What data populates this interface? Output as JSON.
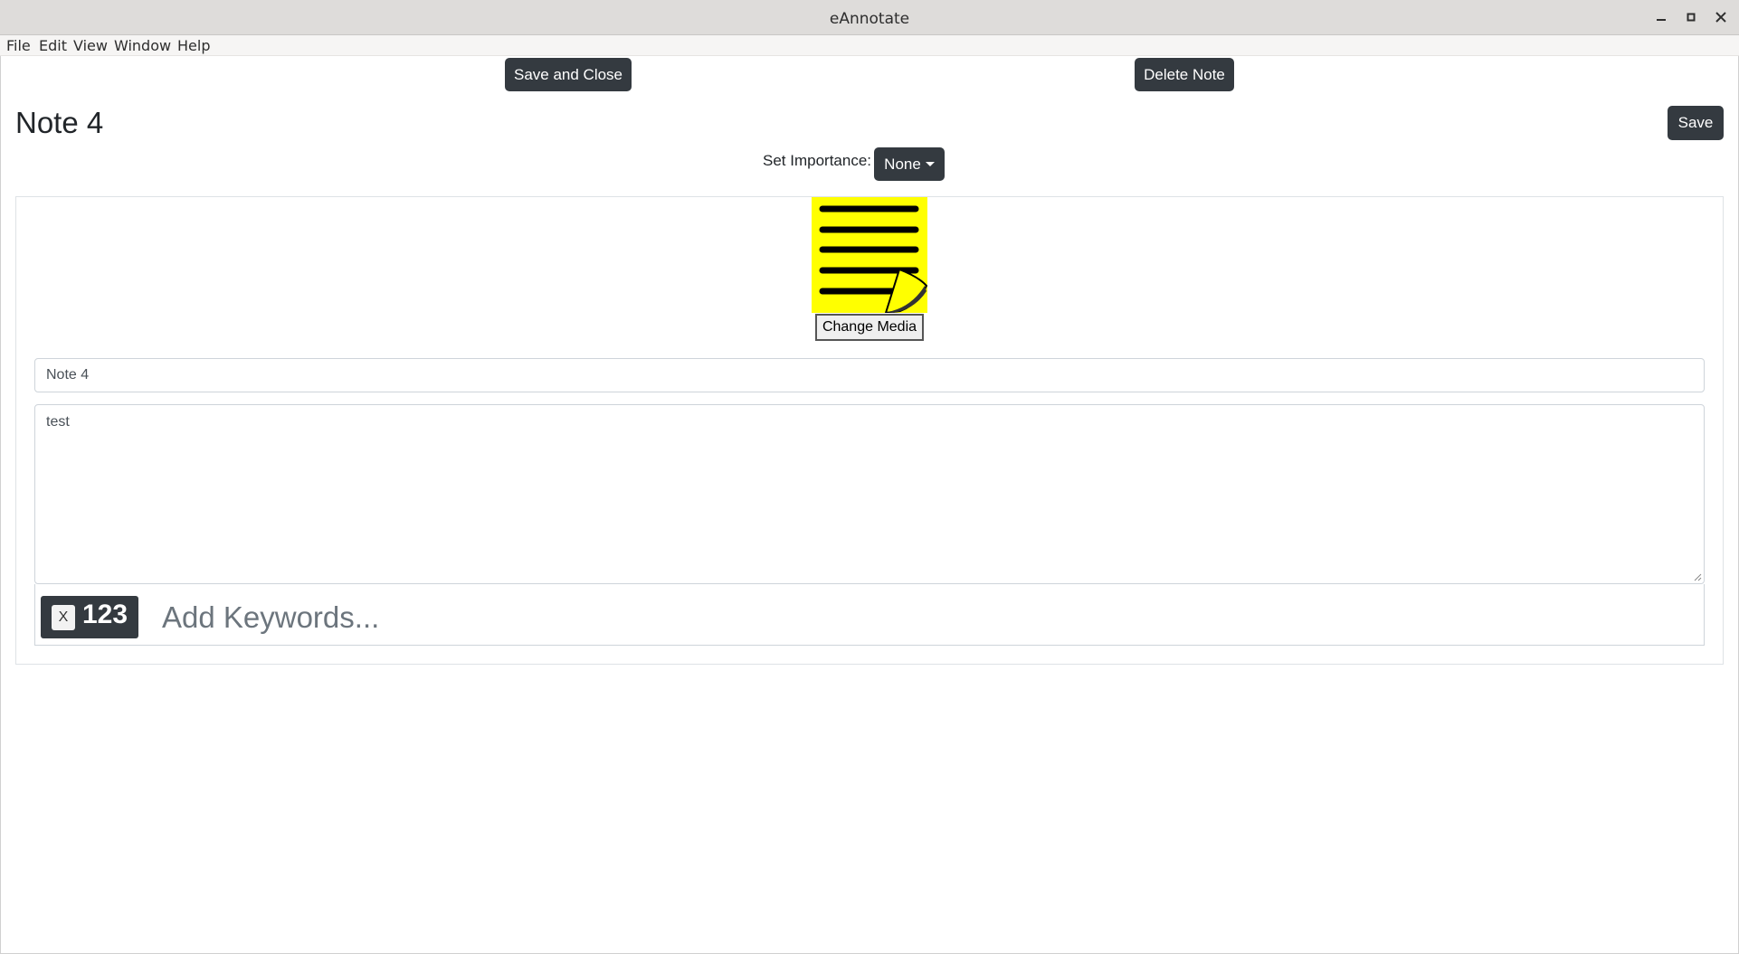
{
  "window": {
    "title": "eAnnotate"
  },
  "menubar": {
    "items": [
      "File",
      "Edit",
      "View",
      "Window",
      "Help"
    ]
  },
  "toolbar": {
    "save_close_label": "Save and Close",
    "delete_label": "Delete Note",
    "save_label": "Save"
  },
  "note": {
    "heading": "Note 4",
    "importance_label": "Set Importance:",
    "importance_value": "None",
    "change_media_label": "Change Media",
    "title_value": "Note 4",
    "body_value": "test",
    "keywords": [
      "123"
    ],
    "keywords_placeholder": "Add Keywords...",
    "keyword_remove_label": "X"
  },
  "icons": {
    "minimize": "minimize-icon",
    "maximize": "maximize-icon",
    "close": "close-icon",
    "note": "sticky-note-icon"
  },
  "colors": {
    "accent_dark": "#343a40",
    "note_yellow": "#ffff00"
  }
}
